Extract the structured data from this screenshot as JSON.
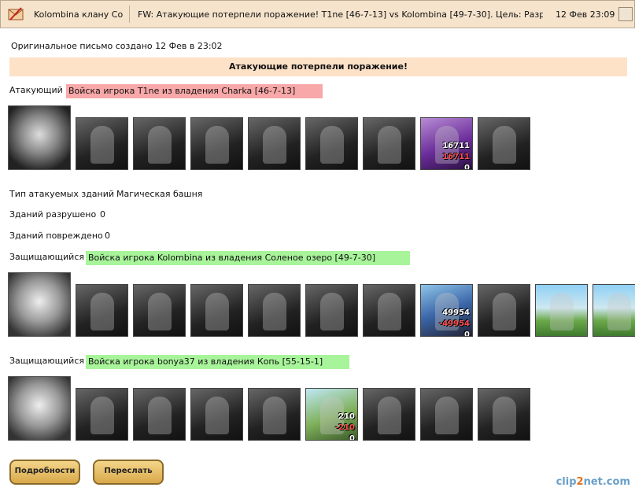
{
  "titlebar": {
    "from": "Kolombina клану Co",
    "subject": "FW: Атакующие потерпели поражение! T1ne [46-7-13] vs Kolombina [49-7-30]. Цель: Разр...",
    "date": "12 Фев 23:09"
  },
  "original_note": "Оригинальное письмо создано 12 Фев в 23:02",
  "banner": "Атакующие потерпели поражение!",
  "attacker": {
    "label": "Атакующий",
    "army": "Войска игрока T1ne из владения Charka [46-7-13]",
    "units": [
      {
        "style": "gray",
        "counts": []
      },
      {
        "style": "gray",
        "counts": []
      },
      {
        "style": "gray",
        "counts": []
      },
      {
        "style": "gray",
        "counts": []
      },
      {
        "style": "gray",
        "counts": []
      },
      {
        "style": "gray",
        "counts": []
      },
      {
        "style": "mage",
        "counts": [
          "16711",
          "16711",
          "0"
        ]
      },
      {
        "style": "gray",
        "counts": []
      }
    ]
  },
  "building_type": {
    "label": "Тип атакуемых зданий",
    "value": "Магическая башня"
  },
  "destroyed": {
    "label": "Зданий разрушено",
    "value": "0"
  },
  "damaged": {
    "label": "Зданий повреждено",
    "value": "0"
  },
  "defender1": {
    "label": "Защищающийся",
    "army": "Войска игрока Kolombina из владения Соленое озеро [49-7-30]",
    "units": [
      {
        "style": "gray",
        "counts": []
      },
      {
        "style": "gray",
        "counts": []
      },
      {
        "style": "gray",
        "counts": []
      },
      {
        "style": "gray",
        "counts": []
      },
      {
        "style": "gray",
        "counts": []
      },
      {
        "style": "gray",
        "counts": []
      },
      {
        "style": "hero",
        "counts": [
          "49954",
          "-49954",
          "0"
        ]
      },
      {
        "style": "gray",
        "counts": []
      },
      {
        "style": "tower",
        "counts": []
      },
      {
        "style": "tower",
        "counts": []
      }
    ]
  },
  "defender2": {
    "label": "Защищающийся",
    "army": "Войска игрока bonya37 из владения Копь [55-15-1]",
    "units": [
      {
        "style": "gray",
        "counts": []
      },
      {
        "style": "gray",
        "counts": []
      },
      {
        "style": "gray",
        "counts": []
      },
      {
        "style": "gray",
        "counts": []
      },
      {
        "style": "archer",
        "counts": [
          "210",
          "-210",
          "0"
        ]
      },
      {
        "style": "gray",
        "counts": []
      },
      {
        "style": "gray",
        "counts": []
      },
      {
        "style": "gray",
        "counts": []
      }
    ]
  },
  "buttons": {
    "details": "Подробности",
    "forward": "Переслать"
  },
  "watermark": {
    "a": "clip",
    "b": "2",
    "c": "net.com"
  }
}
